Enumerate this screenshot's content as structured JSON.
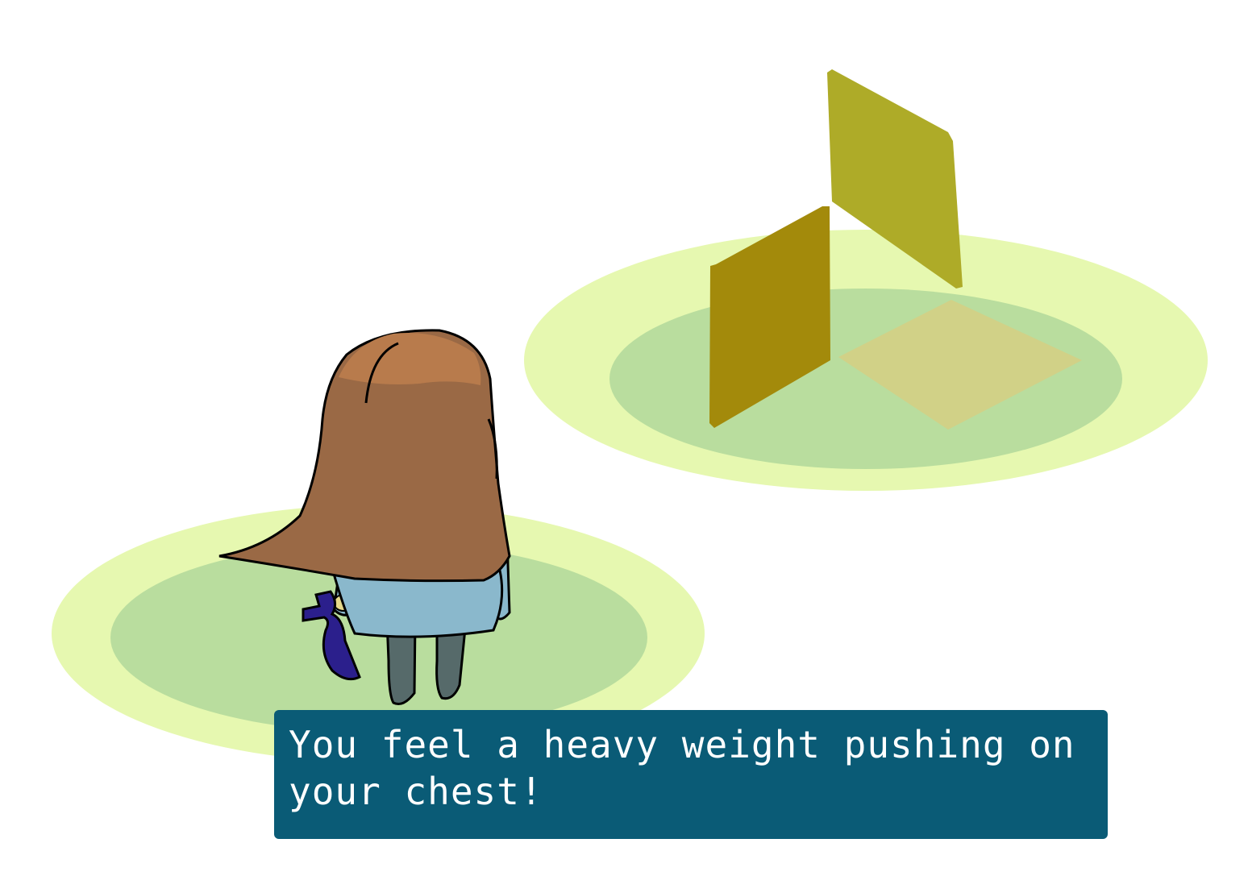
{
  "dialog": {
    "line1": "You feel a heavy weight pushing on",
    "line2": "your chest!"
  },
  "colors": {
    "background": "#ffffff",
    "platform_outer": "#e6f8b0",
    "platform_inner": "#b9dd9e",
    "hair": "#9a6945",
    "hair_highlight": "#b87b4c",
    "shirt": "#8ab8cc",
    "legs": "#566a6a",
    "pouch": "#2b1f8c",
    "panel_light": "#aeab28",
    "panel_dark": "#a38a0b",
    "floor_tile": "#d1d187",
    "dialog_bg": "#0a5b76",
    "dialog_text": "#ffffff"
  }
}
